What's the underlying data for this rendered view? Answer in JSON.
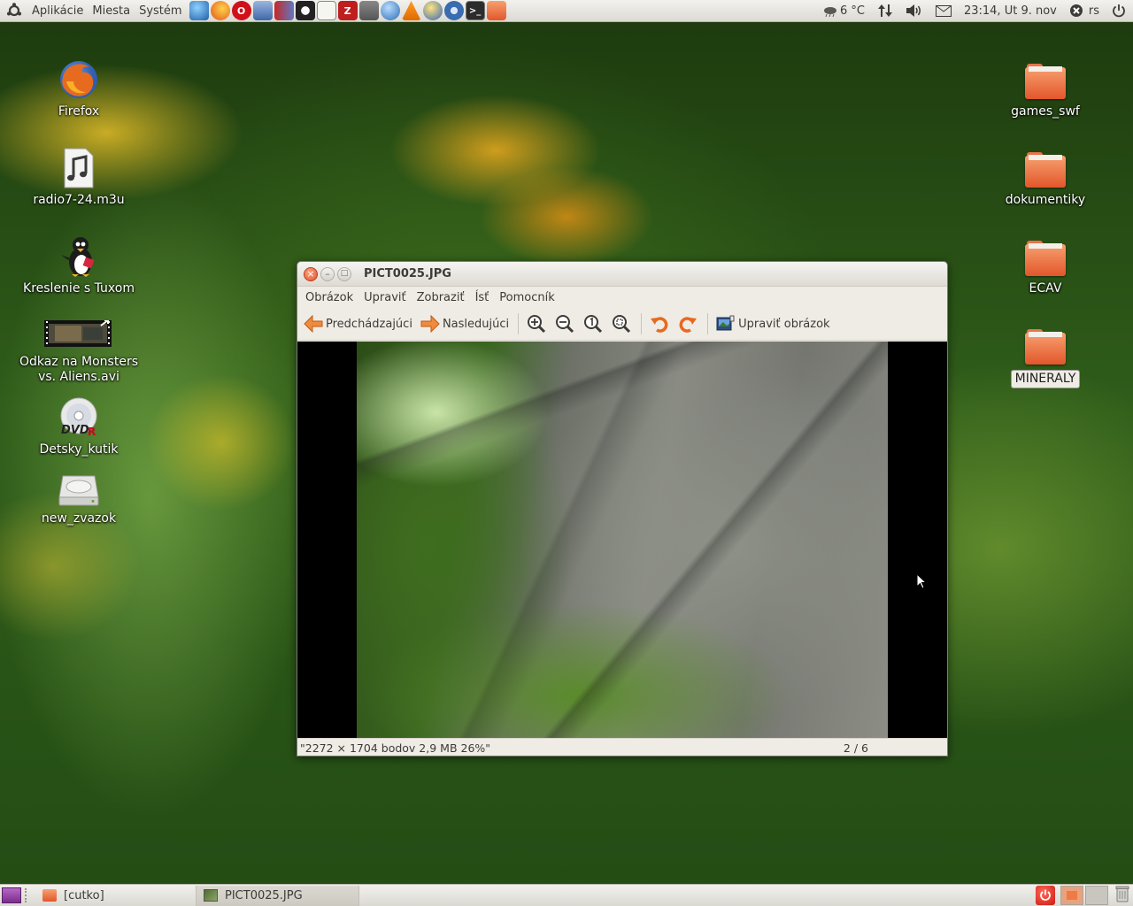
{
  "top_panel": {
    "menus": [
      "Aplikácie",
      "Miesta",
      "Systém"
    ],
    "launchers": [
      "web-browser-icon",
      "firefox-icon",
      "opera-icon",
      "network-monitor-icon",
      "gallery-icon",
      "tux-paint-icon",
      "text-editor-icon",
      "filezilla-icon",
      "paint-brush-icon",
      "globe-icon",
      "vlc-icon",
      "marble-icon",
      "settings-wheel-icon",
      "terminal-icon",
      "update-manager-icon"
    ],
    "weather": "6 °C",
    "clock": "23:14, Ut  9. nov",
    "user": "rs"
  },
  "desktop_left": [
    {
      "name": "Firefox",
      "icon": "firefox-icon"
    },
    {
      "name": "radio7-24.m3u",
      "icon": "audio-file-icon"
    },
    {
      "name": "Kreslenie s Tuxom",
      "icon": "tux-icon"
    },
    {
      "name": "Odkaz na Monsters vs. Aliens.avi",
      "icon": "video-file-icon"
    },
    {
      "name": "Detsky_kutik",
      "icon": "dvd-r-icon"
    },
    {
      "name": "new_zvazok",
      "icon": "drive-icon"
    }
  ],
  "desktop_right": [
    {
      "name": "games_swf",
      "icon": "folder-icon"
    },
    {
      "name": "dokumentiky",
      "icon": "folder-icon"
    },
    {
      "name": "ECAV",
      "icon": "folder-icon"
    },
    {
      "name": "MINERALY",
      "icon": "folder-icon",
      "selected": true
    }
  ],
  "viewer": {
    "title": "PICT0025.JPG",
    "menu": [
      "Obrázok",
      "Upraviť",
      "Zobraziť",
      "Ísť",
      "Pomocník"
    ],
    "toolbar": {
      "prev": "Predchádzajúci",
      "next": "Nasledujúci",
      "edit": "Upraviť obrázok"
    },
    "status": {
      "info": "\"2272 × 1704 bodov  2,9 MB    26%\"",
      "position": "2 / 6"
    }
  },
  "bottom_panel": {
    "tasks": [
      {
        "label": "[cutko]",
        "icon": "folder-icon",
        "active": false
      },
      {
        "label": "PICT0025.JPG",
        "icon": "image-viewer-icon",
        "active": true
      }
    ]
  },
  "colors": {
    "panel": "#dcdad3",
    "accent_orange": "#e2572b",
    "window_bg": "#efece6"
  }
}
